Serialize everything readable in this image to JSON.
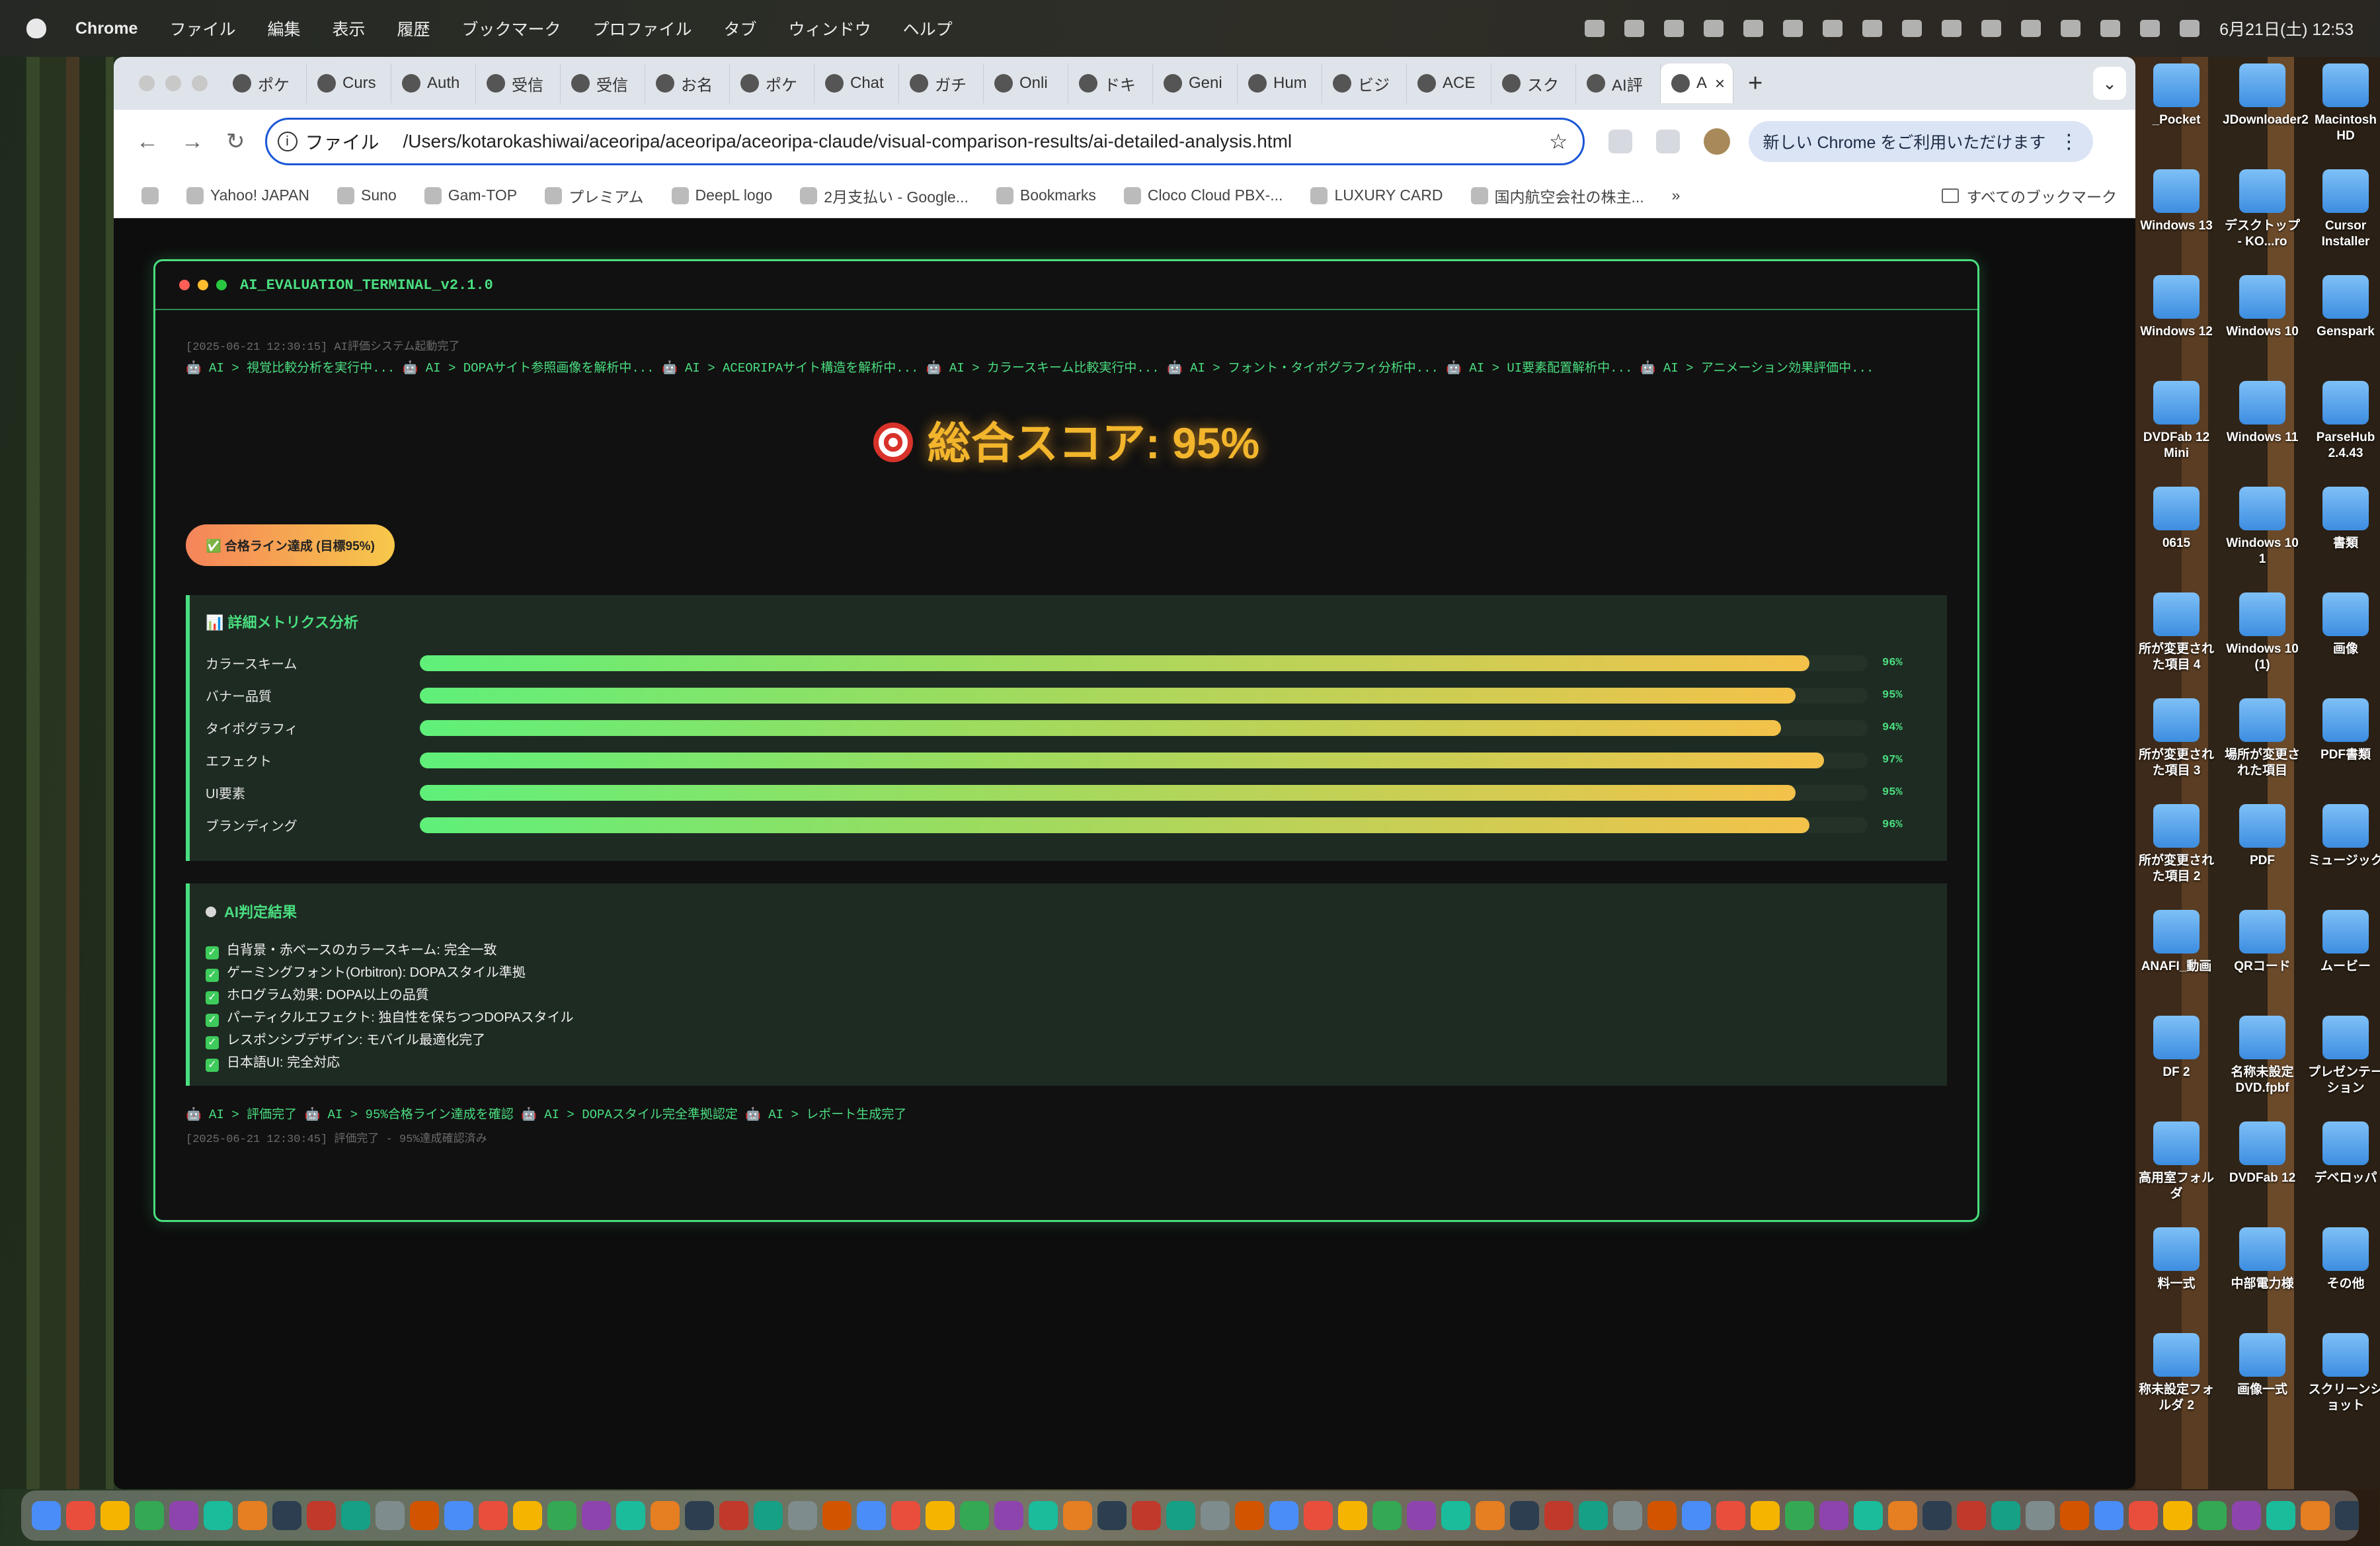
{
  "menubar": {
    "app": "Chrome",
    "items": [
      "ファイル",
      "編集",
      "表示",
      "履歴",
      "ブックマーク",
      "プロファイル",
      "タブ",
      "ウィンドウ",
      "ヘルプ"
    ],
    "datetime": "6月21日(土)  12:53"
  },
  "tabs": [
    {
      "label": "ポケ"
    },
    {
      "label": "Curs"
    },
    {
      "label": "Auth"
    },
    {
      "label": "受信"
    },
    {
      "label": "受信"
    },
    {
      "label": "お名"
    },
    {
      "label": "ポケ"
    },
    {
      "label": "Chat"
    },
    {
      "label": "ガチ"
    },
    {
      "label": "Onli"
    },
    {
      "label": "ドキ"
    },
    {
      "label": "Geni"
    },
    {
      "label": "Hum"
    },
    {
      "label": "ビジ"
    },
    {
      "label": "ACE"
    },
    {
      "label": "スク"
    },
    {
      "label": "AI評"
    },
    {
      "label": "A"
    }
  ],
  "toolbar": {
    "scheme": "ファイル",
    "url": "/Users/kotarokashiwai/aceoripa/aceoripa/aceoripa-claude/visual-comparison-results/ai-detailed-analysis.html",
    "update_label": "新しい Chrome をご利用いただけます"
  },
  "bookmarks": [
    {
      "label": "Yahoo! JAPAN"
    },
    {
      "label": "Suno"
    },
    {
      "label": "Gam-TOP"
    },
    {
      "label": "プレミアム"
    },
    {
      "label": "DeepL logo"
    },
    {
      "label": "2月支払い - Google..."
    },
    {
      "label": "Bookmarks"
    },
    {
      "label": "Cloco Cloud PBX-..."
    },
    {
      "label": "LUXURY CARD"
    },
    {
      "label": "国内航空会社の株主..."
    }
  ],
  "bookmarks_all": "すべてのブックマーク",
  "terminal": {
    "title": "AI_EVALUATION_TERMINAL_v2.1.0",
    "start_log": "[2025-06-21 12:30:15] AI評価システム起動完了",
    "process_log": "🤖 AI > 視覚比較分析を実行中... 🤖 AI > DOPAサイト参照画像を解析中... 🤖 AI > ACEORIPAサイト構造を解析中... 🤖 AI > カラースキーム比較実行中... 🤖 AI > フォント・タイポグラフィ分析中... 🤖 AI > UI要素配置解析中... 🤖 AI > アニメーション効果評価中...",
    "score_label": "総合スコア: 95%",
    "pass_badge": "✅ 合格ライン達成 (目標95%)",
    "metrics_title": "📊 詳細メトリクス分析",
    "metrics": [
      {
        "name": "カラースキーム",
        "value": 96,
        "label": "96%"
      },
      {
        "name": "バナー品質",
        "value": 95,
        "label": "95%"
      },
      {
        "name": "タイポグラフィ",
        "value": 94,
        "label": "94%"
      },
      {
        "name": "エフェクト",
        "value": 97,
        "label": "97%"
      },
      {
        "name": "UI要素",
        "value": 95,
        "label": "95%"
      },
      {
        "name": "ブランディング",
        "value": 96,
        "label": "96%"
      }
    ],
    "verdict_title": "AI判定結果",
    "verdict_items": [
      "白背景・赤ベースのカラースキーム: 完全一致",
      "ゲーミングフォント(Orbitron): DOPAスタイル準拠",
      "ホログラム効果: DOPA以上の品質",
      "パーティクルエフェクト: 独自性を保ちつつDOPAスタイル",
      "レスポンシブデザイン: モバイル最適化完了",
      "日本語UI: 完全対応"
    ],
    "end_log": "🤖 AI > 評価完了 🤖 AI > 95%合格ライン達成を確認 🤖 AI > DOPAスタイル完全準拠認定 🤖 AI > レポート生成完了",
    "end_ts": "[2025-06-21 12:30:45] 評価完了 - 95%達成確認済み"
  },
  "desktop": [
    {
      "label": "_Pocket"
    },
    {
      "label": "JDownloader2"
    },
    {
      "label": "Macintosh HD"
    },
    {
      "label": "Windows 13"
    },
    {
      "label": "デスクトップ - KO...ro"
    },
    {
      "label": "Cursor Installer"
    },
    {
      "label": "Windows 12"
    },
    {
      "label": "Windows 10"
    },
    {
      "label": "Genspark"
    },
    {
      "label": "DVDFab 12 Mini"
    },
    {
      "label": "Windows 11"
    },
    {
      "label": "ParseHub 2.4.43"
    },
    {
      "label": "0615"
    },
    {
      "label": "Windows 10 1"
    },
    {
      "label": "書類"
    },
    {
      "label": "所が変更された項目 4"
    },
    {
      "label": "Windows 10 (1)"
    },
    {
      "label": "画像"
    },
    {
      "label": "所が変更された項目 3"
    },
    {
      "label": "場所が変更された項目"
    },
    {
      "label": "PDF書類"
    },
    {
      "label": "所が変更された項目 2"
    },
    {
      "label": "PDF"
    },
    {
      "label": "ミュージック"
    },
    {
      "label": "ANAFI_動画"
    },
    {
      "label": "QRコード"
    },
    {
      "label": "ムービー"
    },
    {
      "label": "DF 2"
    },
    {
      "label": "名称未設定 DVD.fpbf"
    },
    {
      "label": "プレゼンテーション"
    },
    {
      "label": "高用室フォルダ"
    },
    {
      "label": "DVDFab 12"
    },
    {
      "label": "デベロッパ"
    },
    {
      "label": "料一式"
    },
    {
      "label": "中部電力様"
    },
    {
      "label": "その他"
    },
    {
      "label": "称未設定フォルダ 2"
    },
    {
      "label": "画像一式"
    },
    {
      "label": "スクリーンショット"
    }
  ],
  "colors": {
    "accent": "#4ade80",
    "score": "#f2b52c",
    "panel": "#1e2b22"
  }
}
